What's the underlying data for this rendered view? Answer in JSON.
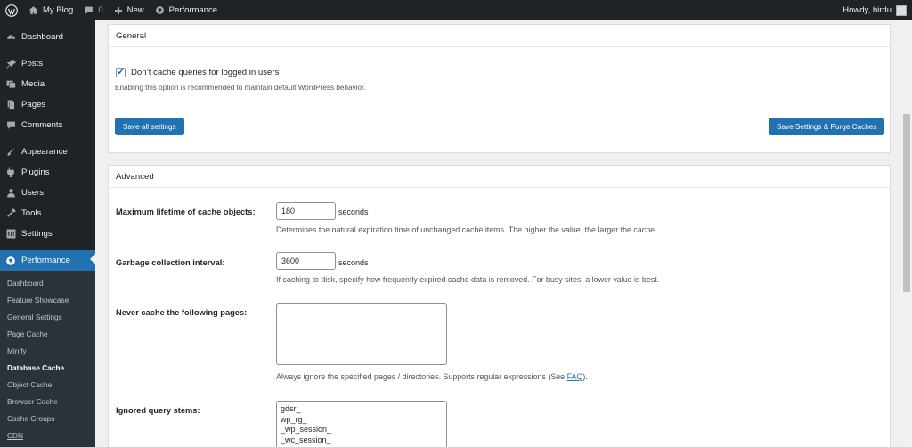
{
  "adminbar": {
    "site_name": "My Blog",
    "comments_count": "0",
    "new_label": "New",
    "performance_label": "Performance",
    "howdy": "Howdy, birdu"
  },
  "sidebar": {
    "items": [
      {
        "label": "Dashboard",
        "icon": "dashboard-icon"
      },
      {
        "label": "Posts",
        "icon": "pin-icon"
      },
      {
        "label": "Media",
        "icon": "media-icon"
      },
      {
        "label": "Pages",
        "icon": "pages-icon"
      },
      {
        "label": "Comments",
        "icon": "comment-icon"
      },
      {
        "label": "Appearance",
        "icon": "brush-icon"
      },
      {
        "label": "Plugins",
        "icon": "plugin-icon"
      },
      {
        "label": "Users",
        "icon": "users-icon"
      },
      {
        "label": "Tools",
        "icon": "wrench-icon"
      },
      {
        "label": "Settings",
        "icon": "settings-icon"
      },
      {
        "label": "Performance",
        "icon": "performance-icon"
      }
    ],
    "submenu": [
      "Dashboard",
      "Feature Showcase",
      "General Settings",
      "Page Cache",
      "Minify",
      "Database Cache",
      "Object Cache",
      "Browser Cache",
      "Cache Groups",
      "CDN"
    ]
  },
  "general": {
    "title": "General",
    "checkbox_label": "Don’t cache queries for logged in users",
    "checkbox_checked": true,
    "checkbox_desc": "Enabling this option is recommended to maintain default WordPress behavior.",
    "save_all": "Save all settings",
    "save_purge": "Save Settings & Purge Caches"
  },
  "advanced": {
    "title": "Advanced",
    "lifetime_label": "Maximum lifetime of cache objects:",
    "lifetime_value": "180",
    "lifetime_unit": "seconds",
    "lifetime_desc": "Determines the natural expiration time of unchanged cache items. The higher the value, the larger the cache.",
    "gc_label": "Garbage collection interval:",
    "gc_value": "3600",
    "gc_unit": "seconds",
    "gc_desc": "If caching to disk, specify how frequently expired cache data is removed. For busy sites, a lower value is best.",
    "never_label": "Never cache the following pages:",
    "never_desc_pre": "Always ignore the specified pages / directories. Supports regular expressions (See ",
    "never_desc_link": "FAQ",
    "never_desc_post": ").",
    "stems_label": "Ignored query stems:",
    "stems": [
      "gdsr_",
      "wp_rg_",
      "_wp_session_",
      "_wc_session_"
    ]
  },
  "colors": {
    "accent": "#2271b1",
    "dark": "#1d2327"
  }
}
